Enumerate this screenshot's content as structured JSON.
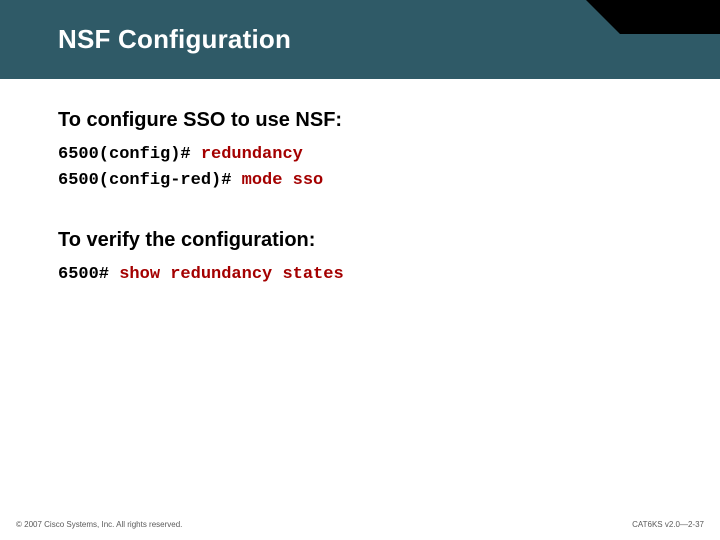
{
  "title": "NSF Configuration",
  "section1": {
    "heading": "To configure SSO to use NSF:",
    "lines": [
      {
        "prompt": "6500(config)# ",
        "cmd": "redundancy"
      },
      {
        "prompt": "6500(config-red)# ",
        "cmd": "mode sso"
      }
    ]
  },
  "section2": {
    "heading": "To verify the configuration:",
    "lines": [
      {
        "prompt": "6500# ",
        "cmd": "show redundancy states"
      }
    ]
  },
  "footer": {
    "left": "© 2007 Cisco Systems, Inc. All rights reserved.",
    "right": "CAT6KS v2.0—2-37"
  }
}
